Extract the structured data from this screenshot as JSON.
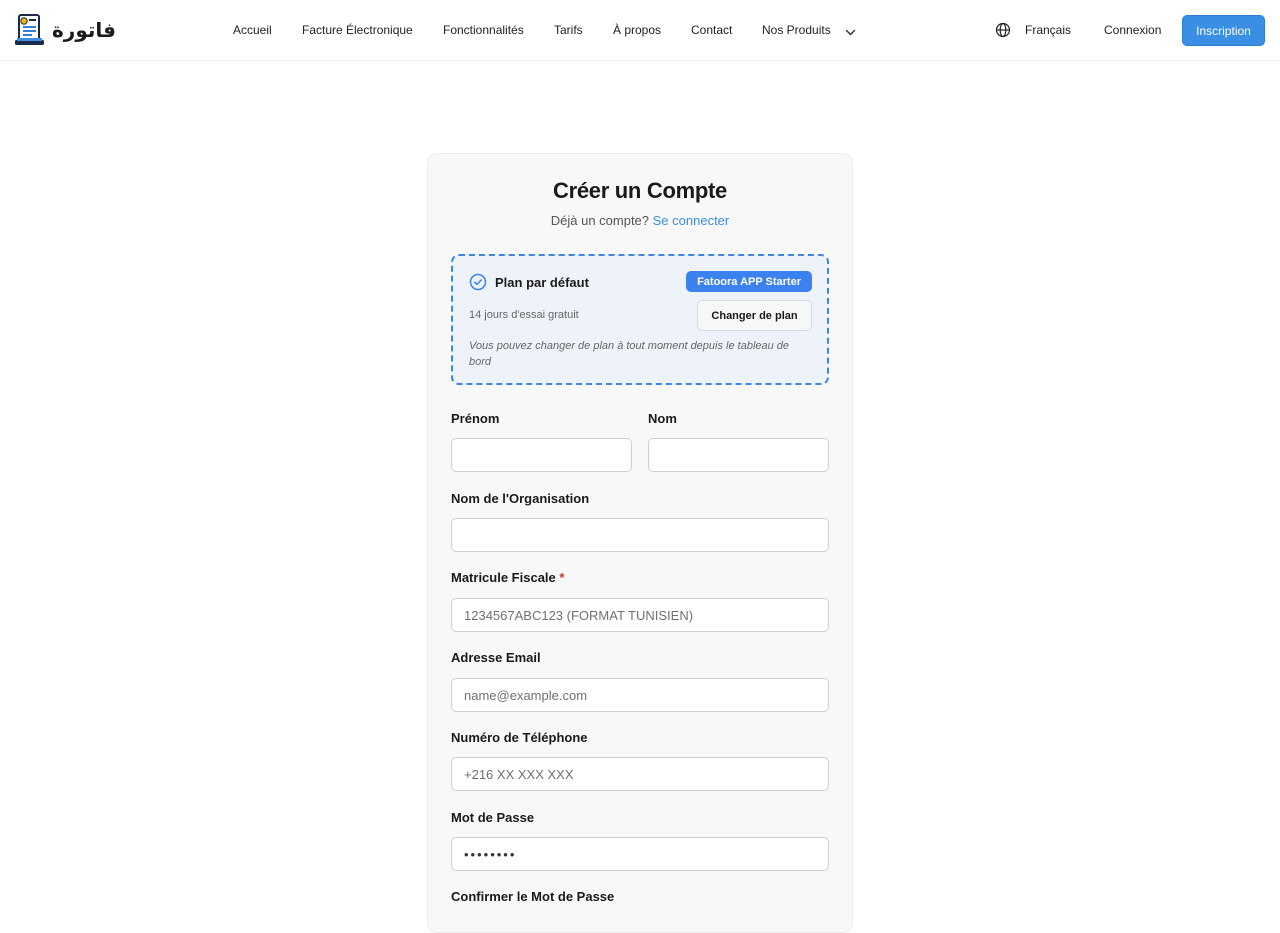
{
  "brand": {
    "name": "فاتورة",
    "logo_icon": "invoice-laptop-icon"
  },
  "nav": {
    "items": [
      "Accueil",
      "Facture Électronique",
      "Fonctionnalités",
      "Tarifs",
      "À propos",
      "Contact",
      "Nos Produits"
    ],
    "language": "Français",
    "login": "Connexion",
    "signup": "Inscription"
  },
  "form": {
    "title": "Créer un Compte",
    "have_account": "Déjà un compte?",
    "login_link": "Se connecter",
    "plan": {
      "title": "Plan par défaut",
      "badge": "Fatoora APP Starter",
      "trial": "14 jours d'essai gratuit",
      "change": "Changer de plan",
      "note": "Vous pouvez changer de plan à tout moment depuis le tableau de bord"
    },
    "first_name": {
      "label": "Prénom",
      "value": "",
      "placeholder": ""
    },
    "last_name": {
      "label": "Nom",
      "value": "",
      "placeholder": ""
    },
    "organization": {
      "label": "Nom de l'Organisation",
      "value": "",
      "placeholder": ""
    },
    "tax_id": {
      "label": "Matricule Fiscale",
      "required_mark": "*",
      "value": "",
      "placeholder": "1234567ABC123 (FORMAT TUNISIEN)"
    },
    "email": {
      "label": "Adresse Email",
      "value": "",
      "placeholder": "name@example.com"
    },
    "phone": {
      "label": "Numéro de Téléphone",
      "value": "",
      "placeholder": "+216 XX XXX XXX"
    },
    "password": {
      "label": "Mot de Passe",
      "value": "••••••••"
    },
    "confirm_password": {
      "label": "Confirmer le Mot de Passe"
    }
  },
  "colors": {
    "accent": "#3a8ee4",
    "plan_border": "#3f86e3",
    "badge": "#3b82f0",
    "required": "#d03030"
  }
}
